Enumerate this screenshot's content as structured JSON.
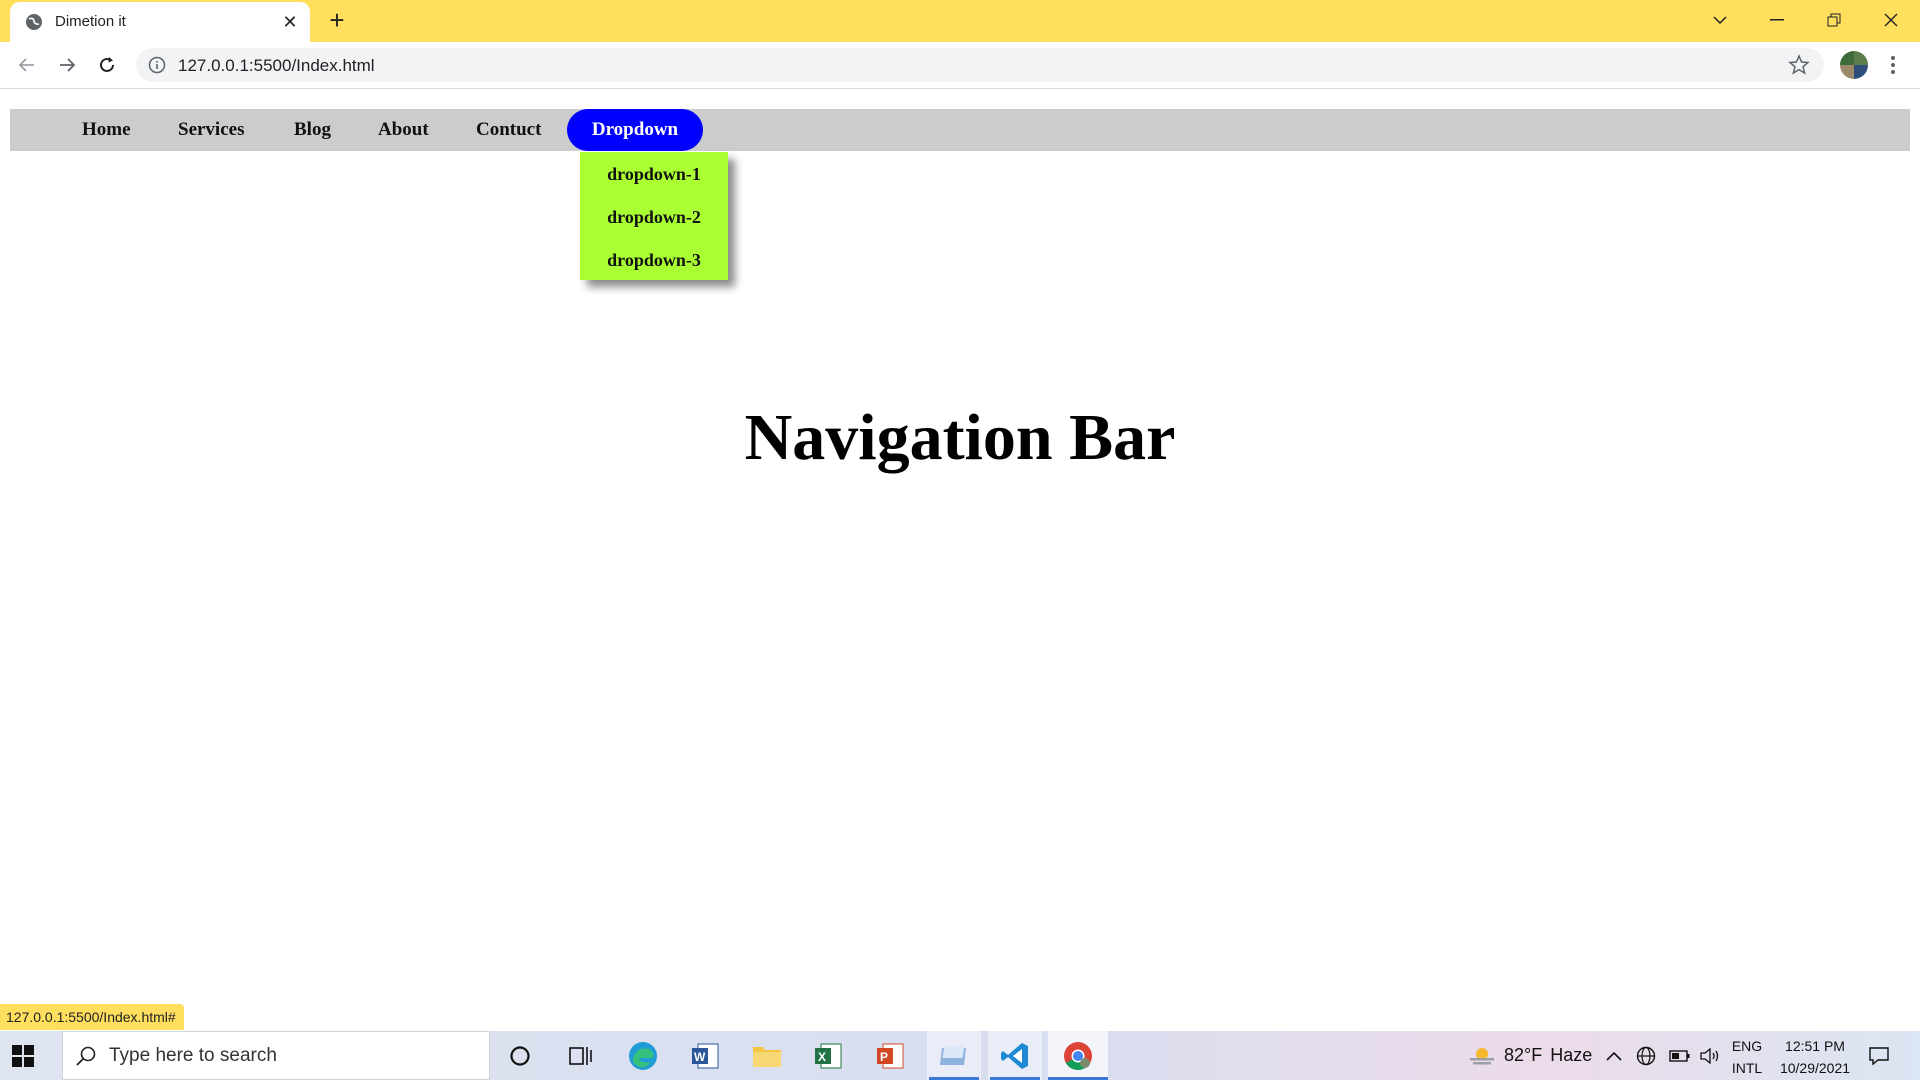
{
  "browser": {
    "tab_title": "Dimetion it",
    "url": "127.0.0.1:5500/Index.html",
    "status_url": "127.0.0.1:5500/Index.html#",
    "accent_color": "#ffdf5d"
  },
  "nav": {
    "items": [
      {
        "label": "Home"
      },
      {
        "label": "Services"
      },
      {
        "label": "Blog"
      },
      {
        "label": "About"
      },
      {
        "label": "Contuct"
      }
    ],
    "dropdown_label": "Dropdown",
    "dropdown_color": "#0000ff",
    "dropdown_items": [
      {
        "label": "dropdown-1"
      },
      {
        "label": "dropdown-2"
      },
      {
        "label": "dropdown-3"
      }
    ],
    "dropdown_menu_color": "#aaff33",
    "bar_color": "#cccccc"
  },
  "page": {
    "heading": "Navigation Bar"
  },
  "taskbar": {
    "search_placeholder": "Type here to search",
    "weather_temp": "82°F",
    "weather_text": "Haze",
    "lang_top": "ENG",
    "lang_bottom": "INTL",
    "time": "12:51 PM",
    "date": "10/29/2021",
    "pinned_icons": [
      "cortana-icon",
      "task-view-icon",
      "edge-icon",
      "word-icon",
      "file-explorer-icon",
      "excel-icon",
      "powerpoint-icon",
      "folder-app-icon",
      "vscode-icon",
      "chrome-icon"
    ]
  }
}
